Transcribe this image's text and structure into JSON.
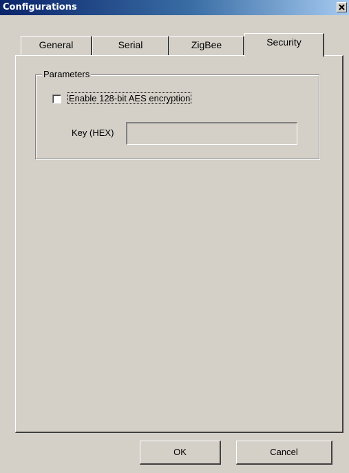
{
  "window": {
    "title": "Configurations",
    "close_label": "close"
  },
  "tabs": [
    {
      "label": "General",
      "active": false
    },
    {
      "label": "Serial",
      "active": false
    },
    {
      "label": "ZigBee",
      "active": false
    },
    {
      "label": "Security",
      "active": true
    }
  ],
  "parameters": {
    "legend": "Parameters",
    "encryption_checkbox": {
      "label": "Enable 128-bit AES encryption",
      "checked": false
    },
    "key": {
      "label": "Key (HEX)",
      "value": ""
    }
  },
  "footer": {
    "ok_label": "OK",
    "cancel_label": "Cancel"
  }
}
